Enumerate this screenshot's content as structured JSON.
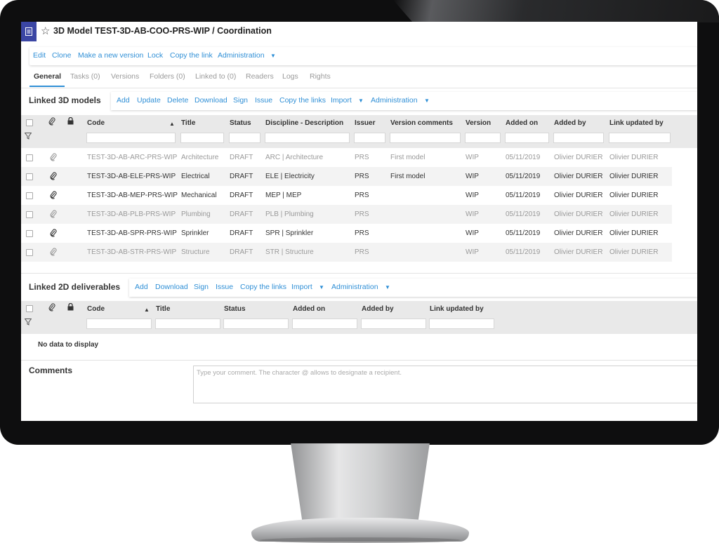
{
  "window": {
    "title": "3D Model TEST-3D-AB-COO-PRS-WIP / Coordination"
  },
  "toolbar": {
    "items": [
      "Edit",
      "Clone",
      "Make a new version",
      "Lock",
      "Copy the link",
      "Administration"
    ]
  },
  "tabs": [
    "General",
    "Tasks (0)",
    "Versions",
    "Folders (0)",
    "Linked to (0)",
    "Readers",
    "Logs",
    "Rights"
  ],
  "models3d": {
    "title": "Linked 3D models",
    "actions": [
      "Add",
      "Update",
      "Delete",
      "Download",
      "Sign",
      "Issue",
      "Copy the links",
      "Import",
      "Administration"
    ],
    "columns": [
      "Code",
      "Title",
      "Status",
      "Discipline - Description",
      "Issuer",
      "Version comments",
      "Version",
      "Added on",
      "Added by",
      "Link updated by"
    ],
    "rows": [
      {
        "code": "TEST-3D-AB-ARC-PRS-WIP",
        "title": "Architecture",
        "status": "DRAFT",
        "discipline": "ARC | Architecture",
        "issuer": "PRS",
        "comments": "First model",
        "version": "WIP",
        "added_on": "05/11/2019",
        "added_by": "Olivier DURIER",
        "link_updated_by": "Olivier DURIER"
      },
      {
        "code": "TEST-3D-AB-ELE-PRS-WIP",
        "title": "Electrical",
        "status": "DRAFT",
        "discipline": "ELE | Electricity",
        "issuer": "PRS",
        "comments": "First model",
        "version": "WIP",
        "added_on": "05/11/2019",
        "added_by": "Olivier DURIER",
        "link_updated_by": "Olivier DURIER"
      },
      {
        "code": "TEST-3D-AB-MEP-PRS-WIP",
        "title": "Mechanical",
        "status": "DRAFT",
        "discipline": "MEP | MEP",
        "issuer": "PRS",
        "comments": "",
        "version": "WIP",
        "added_on": "05/11/2019",
        "added_by": "Olivier DURIER",
        "link_updated_by": "Olivier DURIER"
      },
      {
        "code": "TEST-3D-AB-PLB-PRS-WIP",
        "title": "Plumbing",
        "status": "DRAFT",
        "discipline": "PLB | Plumbing",
        "issuer": "PRS",
        "comments": "",
        "version": "WIP",
        "added_on": "05/11/2019",
        "added_by": "Olivier DURIER",
        "link_updated_by": "Olivier DURIER"
      },
      {
        "code": "TEST-3D-AB-SPR-PRS-WIP",
        "title": "Sprinkler",
        "status": "DRAFT",
        "discipline": "SPR | Sprinkler",
        "issuer": "PRS",
        "comments": "",
        "version": "WIP",
        "added_on": "05/11/2019",
        "added_by": "Olivier DURIER",
        "link_updated_by": "Olivier DURIER"
      },
      {
        "code": "TEST-3D-AB-STR-PRS-WIP",
        "title": "Structure",
        "status": "DRAFT",
        "discipline": "STR | Structure",
        "issuer": "PRS",
        "comments": "",
        "version": "WIP",
        "added_on": "05/11/2019",
        "added_by": "Olivier DURIER",
        "link_updated_by": "Olivier DURIER"
      }
    ]
  },
  "deliverables2d": {
    "title": "Linked 2D deliverables",
    "actions": [
      "Add",
      "Download",
      "Sign",
      "Issue",
      "Copy the links",
      "Import",
      "Administration"
    ],
    "columns": [
      "Code",
      "Title",
      "Status",
      "Added on",
      "Added by",
      "Link updated by"
    ],
    "empty_text": "No data to display"
  },
  "comments": {
    "title": "Comments",
    "placeholder": "Type your comment. The character @ allows to designate a recipient."
  },
  "colors": {
    "accent": "#2f8fd6",
    "doc_icon": "#3b46a4",
    "header_bg": "#e9e9e9"
  }
}
